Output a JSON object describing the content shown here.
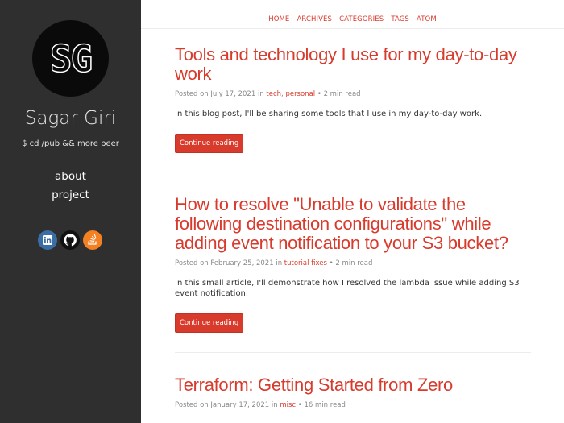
{
  "sidebar": {
    "logo_text": "SG",
    "site_name": "Sagar Giri",
    "tagline": "$ cd /pub && more beer",
    "nav": [
      {
        "label": "about"
      },
      {
        "label": "project"
      }
    ],
    "socials": [
      {
        "icon": "linkedin-icon",
        "color": "#3b6ea5"
      },
      {
        "icon": "github-icon",
        "color": "#111111"
      },
      {
        "icon": "stackoverflow-icon",
        "color": "#f48024"
      }
    ]
  },
  "topnav": {
    "items": [
      {
        "label": "HOME"
      },
      {
        "label": "ARCHIVES"
      },
      {
        "label": "CATEGORIES"
      },
      {
        "label": "TAGS"
      },
      {
        "label": "ATOM"
      }
    ]
  },
  "accent_color": "#d83a2c",
  "posts": [
    {
      "title": "Tools and technology I use for my day-to-day work",
      "posted_prefix": "Posted on",
      "date": "July 17, 2021",
      "in_word": "in",
      "categories": [
        "tech",
        "personal"
      ],
      "read_time": "• 2 min read",
      "excerpt": "In this blog post, I'll be sharing some tools that I use in my day-to-day work.",
      "button": "Continue reading"
    },
    {
      "title": "How to resolve \"Unable to validate the following destination configurations\" while adding event notification to your S3 bucket?",
      "posted_prefix": "Posted on",
      "date": "February 25, 2021",
      "in_word": "in",
      "categories": [
        "tutorial fixes"
      ],
      "read_time": "• 2 min read",
      "excerpt": "In this small article, I'll demonstrate how I resolved the lambda issue while adding S3 event notification.",
      "button": "Continue reading"
    },
    {
      "title": "Terraform: Getting Started from Zero",
      "posted_prefix": "Posted on",
      "date": "January 17, 2021",
      "in_word": "in",
      "categories": [
        "misc"
      ],
      "read_time": "• 16 min read"
    }
  ]
}
